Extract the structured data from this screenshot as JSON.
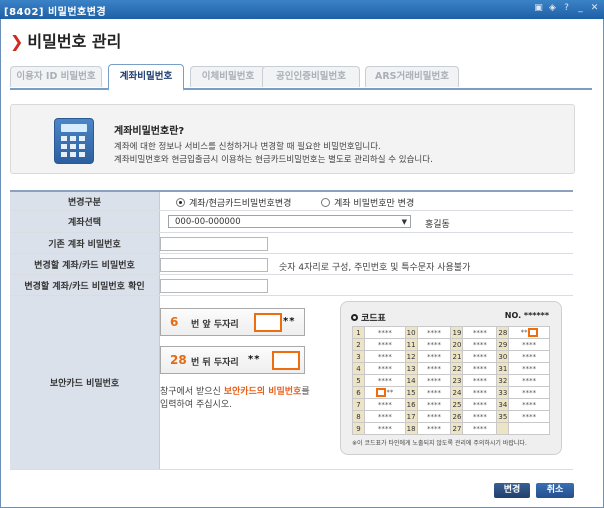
{
  "window": {
    "title": "[8402] 비밀번호변경",
    "buttons": [
      "▣",
      "◈",
      "?",
      "_",
      "✕"
    ]
  },
  "page": {
    "title": "비밀번호 관리"
  },
  "tabs": [
    {
      "label": "이용자 ID 비밀번호",
      "active": false
    },
    {
      "label": "계좌비밀번호",
      "active": true
    },
    {
      "label": "이체비밀번호",
      "active": false
    },
    {
      "label": "공인인증비밀번호",
      "active": false
    },
    {
      "label": "ARS거래비밀번호",
      "active": false
    }
  ],
  "info": {
    "heading": "계좌비밀번호란?",
    "desc1": "계좌에 대한 정보나 서비스를 신청하거나 변경할 때 필요한 비밀번호입니다.",
    "desc2": "계좌비밀번호와 현금입출금시 이용하는 현금카드비밀번호는 별도로 관리하실 수 있습니다."
  },
  "form": {
    "change_type_label": "변경구분",
    "option1": "계좌/현금카드비밀번호변경",
    "option2": "계좌 비밀번호만 변경",
    "account_label": "계좌선택",
    "account_value": "000-00-000000",
    "owner": "홍길동",
    "current_pw_label": "기존 계좌 비밀번호",
    "new_pw_label": "변경할 계좌/카드 비밀번호",
    "new_pw_hint": "숫자 4자리로 구성, 주민번호 및 특수문자 사용불가",
    "confirm_pw_label": "변경할 계좌/카드 비밀번호 확인",
    "security_label": "보안카드 비밀번호"
  },
  "security": {
    "front_num": "6",
    "front_text": "번 앞 두자리",
    "front_stars": "**",
    "back_num": "28",
    "back_text": "번 뒤 두자리",
    "back_stars": "**",
    "note_pre": "창구에서 받으신 ",
    "note_bold": "보안카드의 비밀번호",
    "note_post": "를",
    "note2": "입력하여 주십시오."
  },
  "card": {
    "title": "코드표",
    "no": "NO. ******",
    "stars": "****",
    "footnote": "※이 코드표가 타인에게 노출되지 않도록 관리에 주의하시기 바랍니다."
  },
  "buttons": {
    "change": "변경",
    "cancel": "취소"
  },
  "colors": {
    "accent": "#e56a12",
    "titlebar": "#2766ab",
    "tab_active": "#1c3d6e"
  }
}
